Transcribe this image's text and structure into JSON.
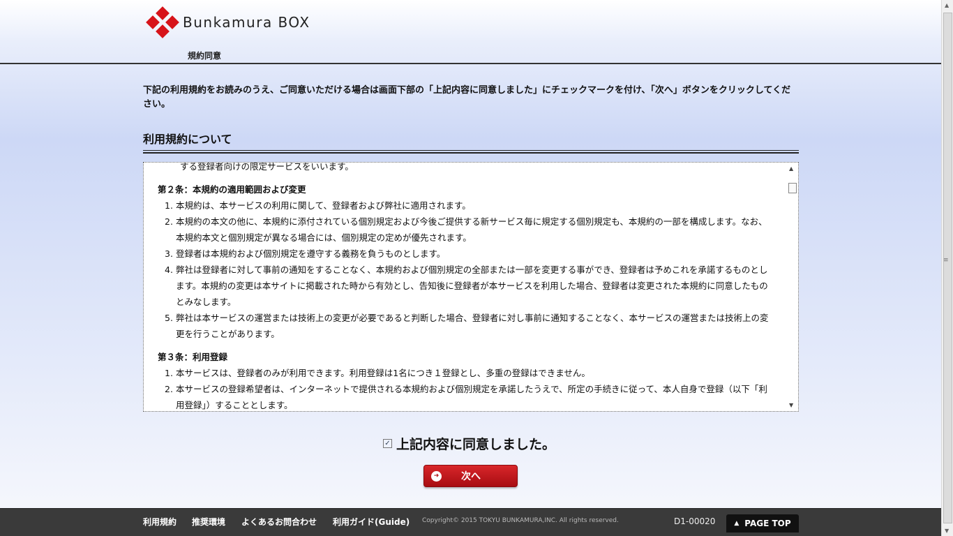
{
  "header": {
    "logo_text": "Bunkamura BOX",
    "breadcrumb": "規約同意"
  },
  "main": {
    "instruction": "下記の利用規約をお読みのうえ、ご同意いただける場合は画面下部の「上記内容に同意しました」にチェックマークを付け、「次へ」ボタンをクリックしてください。",
    "section_title": "利用規約について",
    "terms": {
      "cut_line": "する登録者向けの限定サービスをいいます。",
      "article2": {
        "title": "第２条：本規約の適用範囲および変更",
        "items": [
          "本規約は、本サービスの利用に関して、登録者および弊社に適用されます。",
          "本規約の本文の他に、本規約に添付されている個別規定および今後ご提供する新サービス毎に規定する個別規定も、本規約の一部を構成します。なお、本規約本文と個別規定が異なる場合には、個別規定の定めが優先されます。",
          "登録者は本規約および個別規定を遵守する義務を負うものとします。",
          "弊社は登録者に対して事前の通知をすることなく、本規約および個別規定の全部または一部を変更する事ができ、登録者は予めこれを承諾するものとします。本規約の変更は本サイトに掲載された時から有効とし、告知後に登録者が本サービスを利用した場合、登録者は変更された本規約に同意したものとみなします。",
          "弊社は本サービスの運営または技術上の変更が必要であると判断した場合、登録者に対し事前に通知することなく、本サービスの運営または技術上の変更を行うことがあります。"
        ]
      },
      "article3": {
        "title": "第３条：利用登録",
        "items": [
          "本サービスは、登録者のみが利用できます。利用登録は1名につき１登録とし、多重の登録はできません。",
          "本サービスの登録希望者は、インターネットで提供される本規約および個別規定を承諾したうえで、所定の手続きに従って、本人自身で登録（以下「利用登録」）することとします。"
        ]
      }
    },
    "agree_label": "上記内容に同意しました。",
    "agree_checked": true,
    "next_label": "次へ"
  },
  "footer": {
    "links": [
      "利用規約",
      "推奨環境",
      "よくあるお問合わせ",
      "利用ガイド(Guide)"
    ],
    "copyright": "Copyright© 2015 TOKYU BUNKAMURA,INC. All rights reserved.",
    "page_code": "D1-00020",
    "page_top": "PAGE TOP"
  },
  "colors": {
    "brand_red": "#d7141a",
    "footer_bg": "#3a3a3a",
    "button_red": "#c01a1f"
  },
  "icons": {
    "next": "arrow-right-circle-icon",
    "page_top": "chevron-up-icon"
  }
}
